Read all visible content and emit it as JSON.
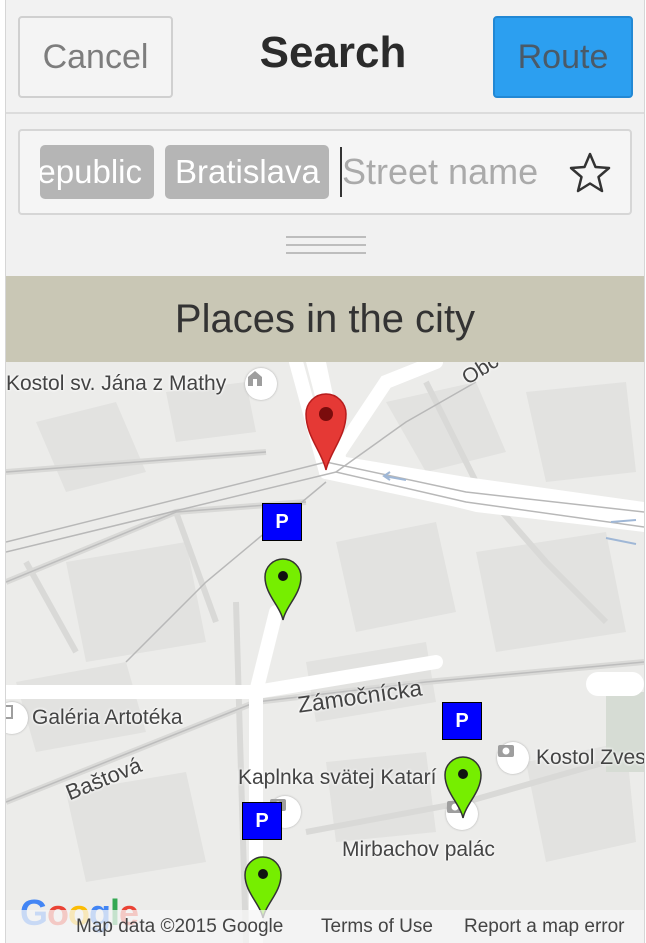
{
  "header": {
    "cancel_label": "Cancel",
    "title": "Search",
    "route_label": "Route"
  },
  "search": {
    "chips": [
      "epublic",
      "Bratislava"
    ],
    "placeholder": "Street name",
    "favorite_icon": "star-outline-icon"
  },
  "section": {
    "title": "Places in the city"
  },
  "map": {
    "labels": {
      "kostol_jana": "Kostol sv. Jána z Mathy",
      "obc": "Obc",
      "galeria": "Galéria Artotéka",
      "zamocnicka": "Zámočnícka",
      "bastova": "Baštová",
      "kaplnka": "Kaplnka svätej Katarí",
      "kostol_zves": "Kostol Zves",
      "mirbachov": "Mirbachov palác"
    },
    "parking_label": "P",
    "colors": {
      "selected_pin": "#e53935",
      "place_pin": "#76ee00",
      "parking": "#0000ff"
    },
    "footer": {
      "logo": "Google",
      "map_data": "Map data ©2015 Google",
      "terms": "Terms of Use",
      "report": "Report a map error"
    }
  }
}
